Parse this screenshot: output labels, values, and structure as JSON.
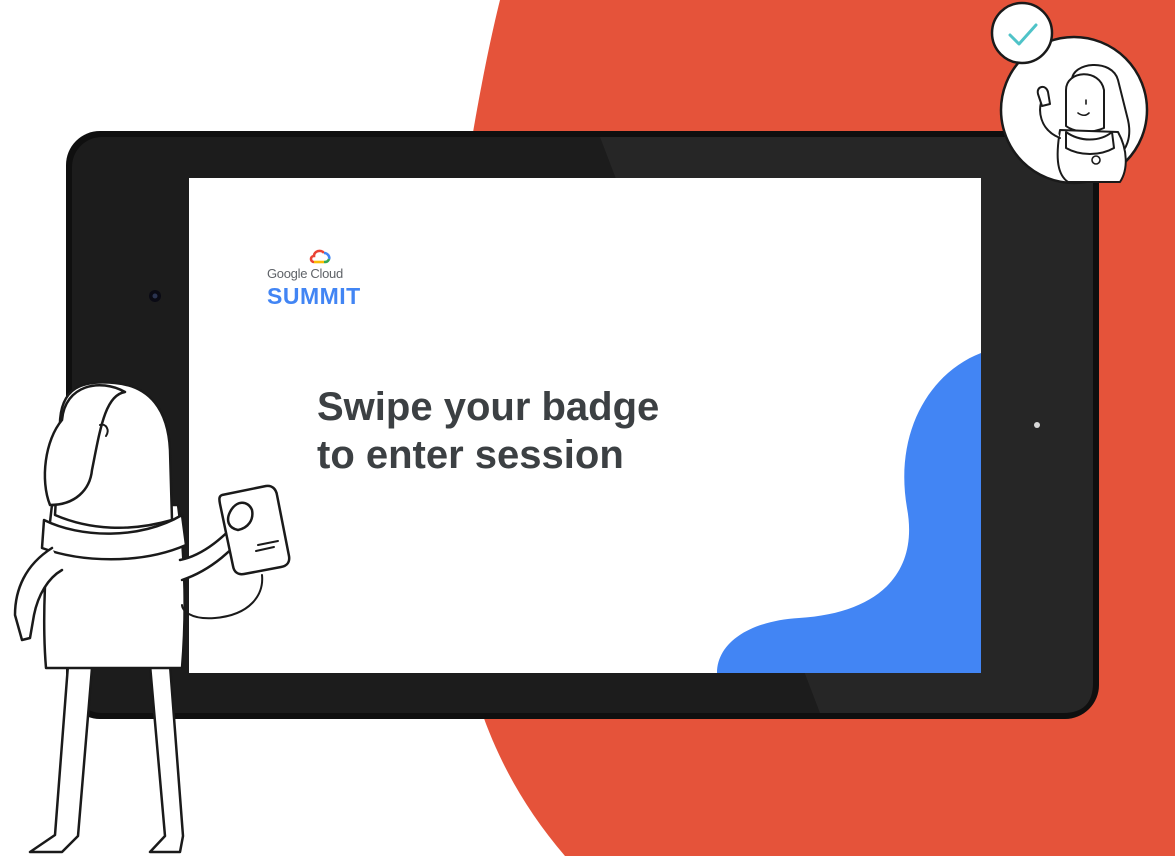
{
  "screen": {
    "brand": "Google Cloud",
    "event": "SUMMIT",
    "headline_line1": "Swipe your badge",
    "headline_line2": "to enter session"
  },
  "icons": {
    "logo": "google-cloud-logo-icon",
    "check": "checkmark-icon",
    "camera": "camera-icon",
    "sensor": "sensor-icon"
  },
  "colors": {
    "background_blob": "#e5533a",
    "tablet_body": "#141414",
    "screen_bg": "#ffffff",
    "accent_blue": "#4285f4",
    "headline_text": "#3c4043",
    "check_color": "#4fc3c8"
  }
}
